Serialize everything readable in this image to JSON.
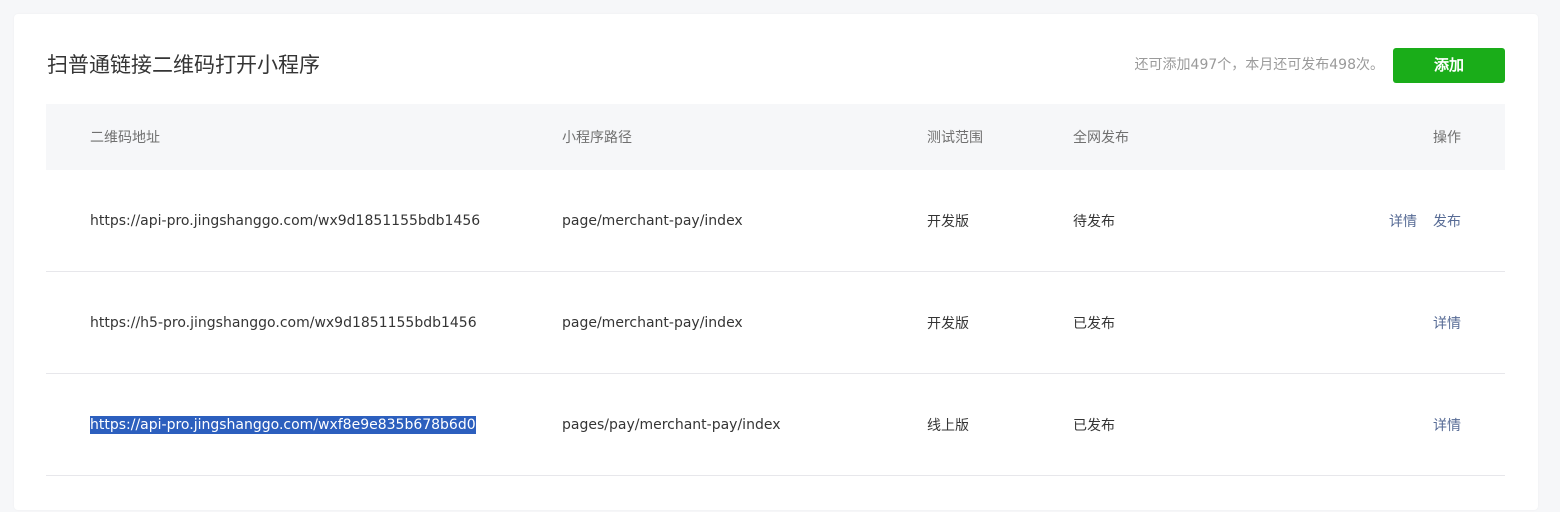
{
  "header": {
    "title": "扫普通链接二维码打开小程序",
    "quota_text": "还可添加497个，本月还可发布498次。",
    "add_label": "添加"
  },
  "table": {
    "columns": [
      "二维码地址",
      "小程序路径",
      "测试范围",
      "全网发布",
      "操作"
    ],
    "rows": [
      {
        "url": "https://api-pro.jingshanggo.com/wx9d1851155bdb1456",
        "path": "page/merchant-pay/index",
        "scope": "开发版",
        "publish": "待发布",
        "actions": [
          "详情",
          "发布"
        ]
      },
      {
        "url": "https://h5-pro.jingshanggo.com/wx9d1851155bdb1456",
        "path": "page/merchant-pay/index",
        "scope": "开发版",
        "publish": "已发布",
        "actions": [
          "详情"
        ]
      },
      {
        "url": "https://api-pro.jingshanggo.com/wxf8e9e835b678b6d0",
        "path": "pages/pay/merchant-pay/index",
        "scope": "线上版",
        "publish": "已发布",
        "actions": [
          "详情"
        ]
      }
    ]
  },
  "colors": {
    "accent_green": "#1aad19",
    "link_blue": "#576b95",
    "selection": "#2c5fbe"
  }
}
